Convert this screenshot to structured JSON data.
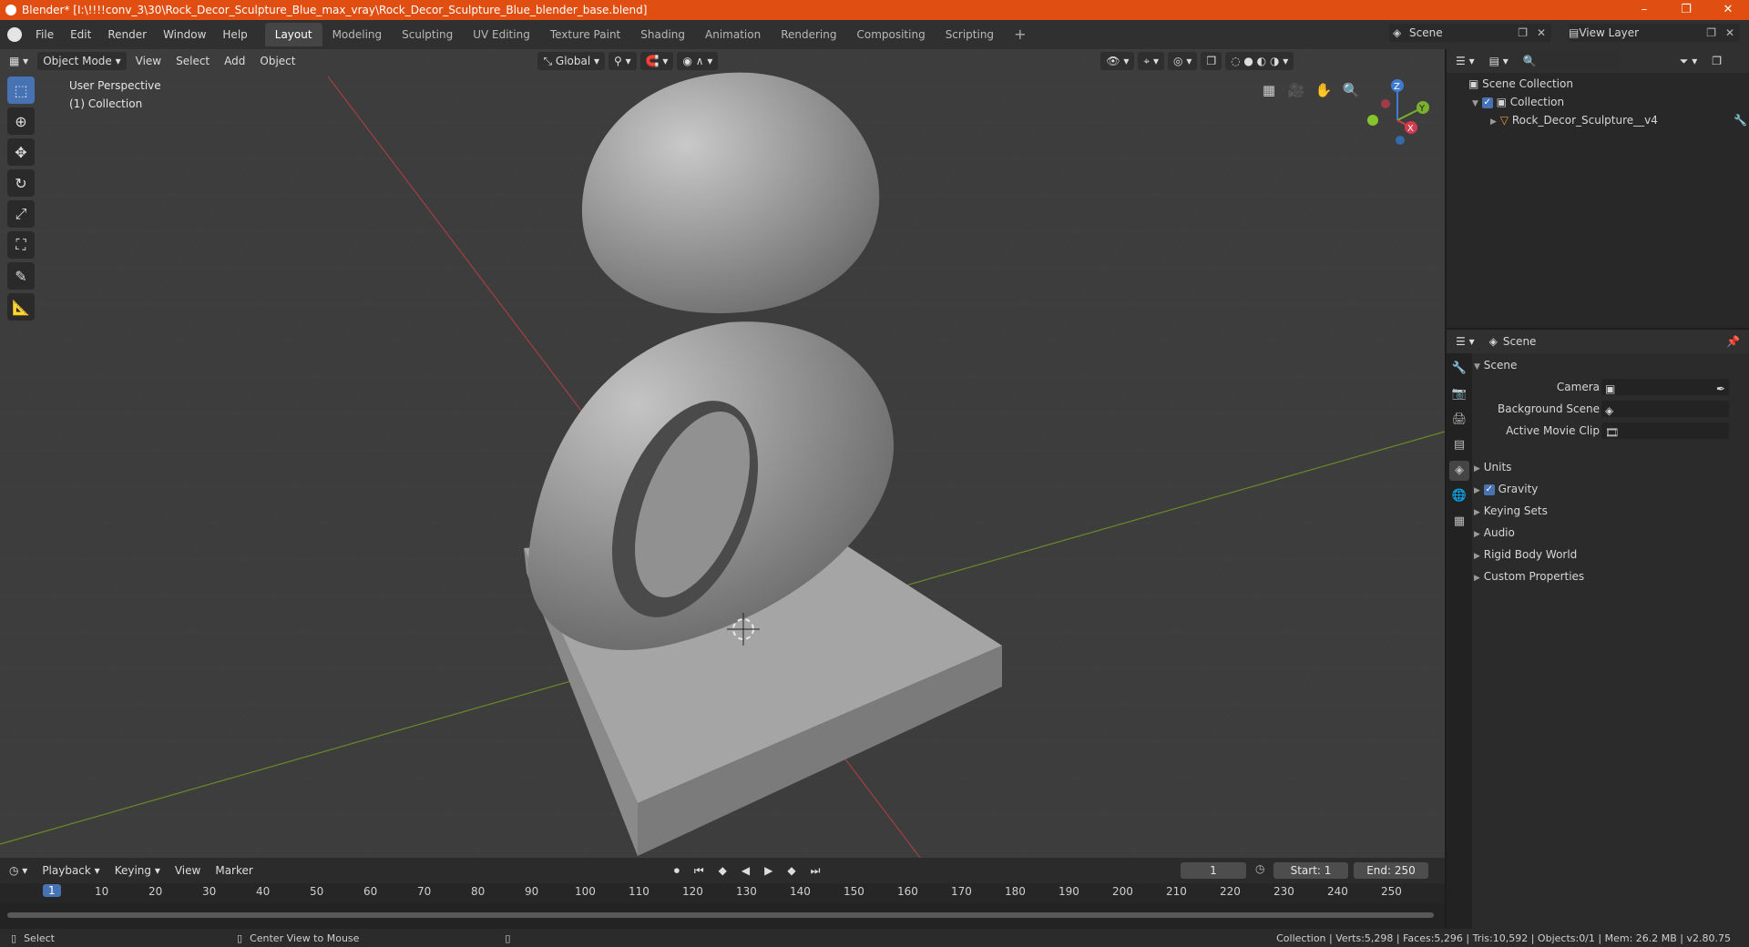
{
  "window": {
    "title": "Blender* [I:\\!!!!conv_3\\30\\Rock_Decor_Sculpture_Blue_max_vray\\Rock_Decor_Sculpture_Blue_blender_base.blend]",
    "min": "–",
    "max": "❐",
    "close": "✕"
  },
  "menu": [
    "File",
    "Edit",
    "Render",
    "Window",
    "Help"
  ],
  "workspaces": [
    "Layout",
    "Modeling",
    "Sculpting",
    "UV Editing",
    "Texture Paint",
    "Shading",
    "Animation",
    "Rendering",
    "Compositing",
    "Scripting"
  ],
  "workspace_add": "+",
  "scene_selector": {
    "value": "Scene"
  },
  "view_layer_selector": {
    "value": "View Layer"
  },
  "viewport": {
    "mode": "Object Mode",
    "menus": [
      "View",
      "Select",
      "Add",
      "Object"
    ],
    "orientation": "Global",
    "info_line1": "User Perspective",
    "info_line2": "(1) Collection",
    "gizmo": {
      "x": "X",
      "y": "Y",
      "z": "Z"
    }
  },
  "outliner": {
    "root": "Scene Collection",
    "collection": "Collection",
    "object": "Rock_Decor_Sculpture__v4"
  },
  "properties": {
    "header": "Scene",
    "panel_title": "Scene",
    "camera_label": "Camera",
    "background_scene_label": "Background Scene",
    "active_movie_clip_label": "Active Movie Clip",
    "sections": [
      "Units",
      "Gravity",
      "Keying Sets",
      "Audio",
      "Rigid Body World",
      "Custom Properties"
    ]
  },
  "timeline": {
    "menus": [
      "Playback",
      "Keying",
      "View",
      "Marker"
    ],
    "current_frame": "1",
    "start_label": "Start:",
    "start_value": "1",
    "end_label": "End:",
    "end_value": "250",
    "ticks": [
      "10",
      "20",
      "30",
      "40",
      "50",
      "60",
      "70",
      "80",
      "90",
      "100",
      "110",
      "120",
      "130",
      "140",
      "150",
      "160",
      "170",
      "180",
      "190",
      "200",
      "210",
      "220",
      "230",
      "240",
      "250"
    ],
    "playhead": "1"
  },
  "statusbar": {
    "left1": "Select",
    "left2": "Center View to Mouse",
    "right": "Collection | Verts:5,298 | Faces:5,296 | Tris:10,592 | Objects:0/1 | Mem: 26.2 MB | v2.80.75"
  }
}
